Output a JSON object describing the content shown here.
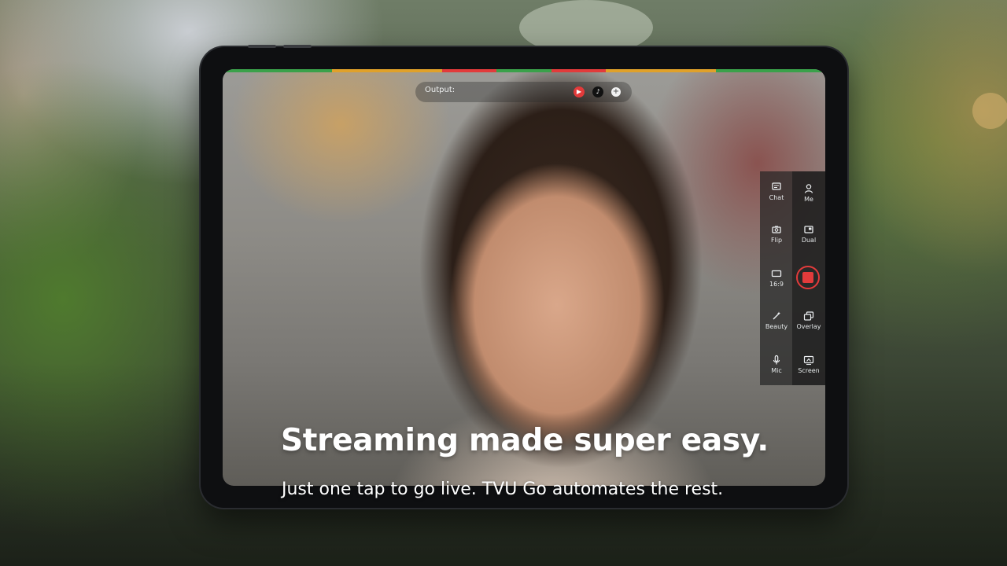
{
  "output": {
    "label": "Output:",
    "destinations": [
      {
        "name": "youtube-icon",
        "glyph": "▶"
      },
      {
        "name": "tiktok-icon",
        "glyph": "♪"
      },
      {
        "name": "add-icon",
        "glyph": "+"
      }
    ]
  },
  "controls": {
    "chat": "Chat",
    "me": "Me",
    "flip": "Flip",
    "dual": "Dual",
    "aspect": "16:9",
    "beauty": "Beauty",
    "overlay": "Overlay",
    "mic": "Mic",
    "screen": "Screen"
  },
  "status_strip_colors": [
    "#3aa14a",
    "#3aa14a",
    "#e0a12a",
    "#e0a12a",
    "#e23b3b",
    "#3aa14a",
    "#e23b3b",
    "#e0a12a",
    "#e0a12a",
    "#3aa14a",
    "#3aa14a"
  ],
  "accent": "#e23b3b",
  "caption": {
    "headline": "Streaming made super easy.",
    "subline": "Just one tap to go live. TVU Go automates the rest."
  }
}
